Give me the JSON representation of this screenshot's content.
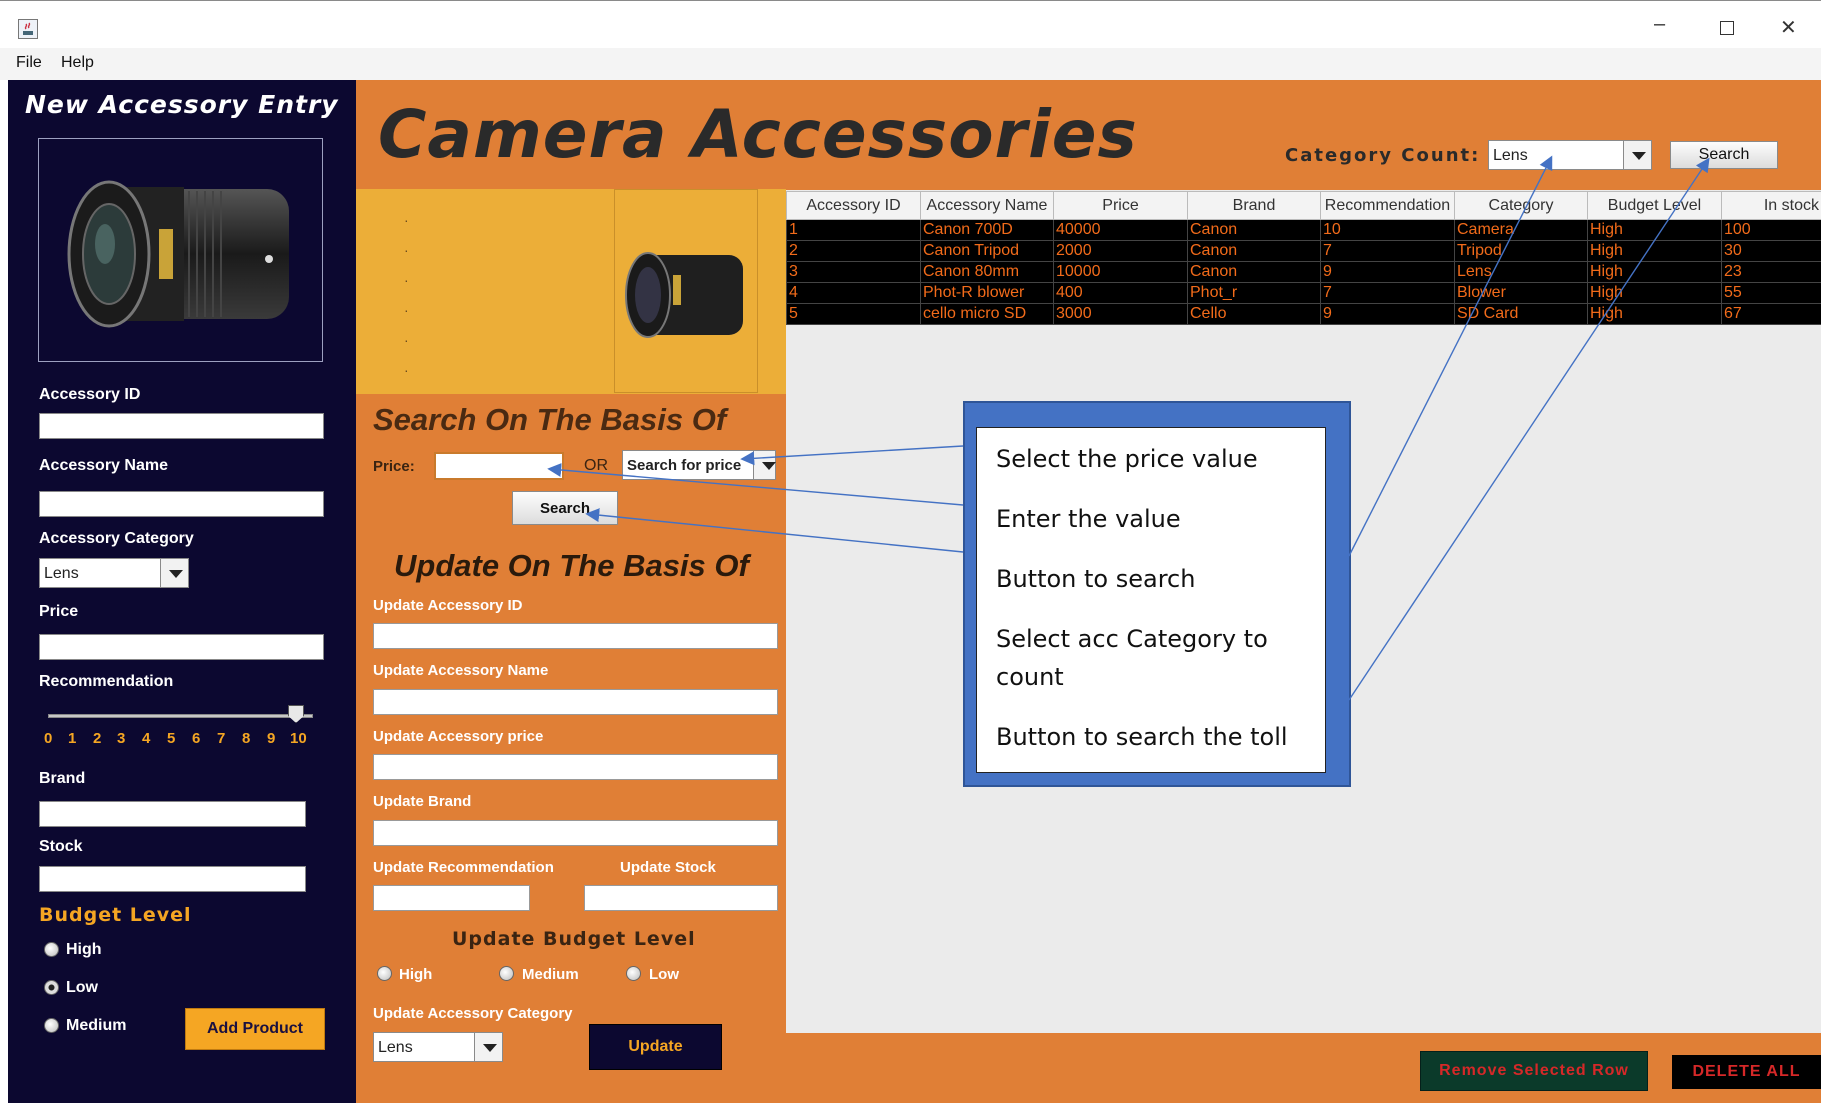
{
  "menu": {
    "file": "File",
    "help": "Help"
  },
  "window_controls": {
    "minimize": "–",
    "maximize": "☐",
    "close": "✕"
  },
  "left": {
    "title": "New Accessory Entry",
    "labels": {
      "id": "Accessory ID",
      "name": "Accessory Name",
      "category": "Accessory Category",
      "price": "Price",
      "recommendation": "Recommendation",
      "brand": "Brand",
      "stock": "Stock",
      "budget": "Budget Level"
    },
    "category_value": "Lens",
    "slider_ticks": [
      "0",
      "1",
      "2",
      "3",
      "4",
      "5",
      "6",
      "7",
      "8",
      "9",
      "10"
    ],
    "slider_value": 10,
    "budget_options": {
      "high": "High",
      "low": "Low",
      "medium": "Medium"
    },
    "budget_selected": "Low",
    "add_button": "Add Product"
  },
  "center": {
    "app_title": "Camera Accessories",
    "search_heading": "Search On The Basis Of",
    "price_label": "Price:",
    "or_label": "OR",
    "search_for_price": "Search for price",
    "search_button": "Search",
    "update_heading": "Update On The Basis Of",
    "update_labels": {
      "id": "Update Accessory ID",
      "name": "Update Accessory Name",
      "price": "Update Accessory price",
      "brand": "Update Brand",
      "recommendation": "Update Recommendation",
      "stock": "Update Stock",
      "budget": "Update Budget Level",
      "category": "Update Accessory Category"
    },
    "update_budget": {
      "high": "High",
      "medium": "Medium",
      "low": "Low"
    },
    "update_category_value": "Lens",
    "update_button": "Update"
  },
  "right": {
    "category_count_label": "Category Count:",
    "category_count_value": "Lens",
    "search_button": "Search",
    "remove_button": "Remove Selected Row",
    "delete_all_button": "DELETE ALL"
  },
  "table": {
    "columns": [
      "Accessory ID",
      "Accessory Name",
      "Price",
      "Brand",
      "Recommendation",
      "Category",
      "Budget Level",
      "In stock"
    ],
    "rows": [
      [
        "1",
        "Canon 700D",
        "40000",
        "Canon",
        "10",
        "Camera",
        "High",
        "100"
      ],
      [
        "2",
        "Canon Tripod",
        "2000",
        "Canon",
        "7",
        "Tripod",
        "High",
        "30"
      ],
      [
        "3",
        "Canon 80mm",
        "10000",
        "Canon",
        "9",
        "Lens",
        "High",
        "23"
      ],
      [
        "4",
        "Phot-R blower",
        "400",
        "Phot_r",
        "7",
        "Blower",
        "High",
        "55"
      ],
      [
        "5",
        "cello micro SD",
        "3000",
        "Cello",
        "9",
        "SD Card",
        "High",
        "67"
      ]
    ]
  },
  "callout": {
    "lines": [
      "Select the price value",
      "Enter the value",
      "Button to search",
      "Select acc Category to count",
      "Button to search the toll"
    ]
  },
  "colors": {
    "navy": "#0c0830",
    "orange": "#e07f36",
    "gold": "#ecae38",
    "table_text": "#f26b1a",
    "callout": "#4472c4"
  }
}
